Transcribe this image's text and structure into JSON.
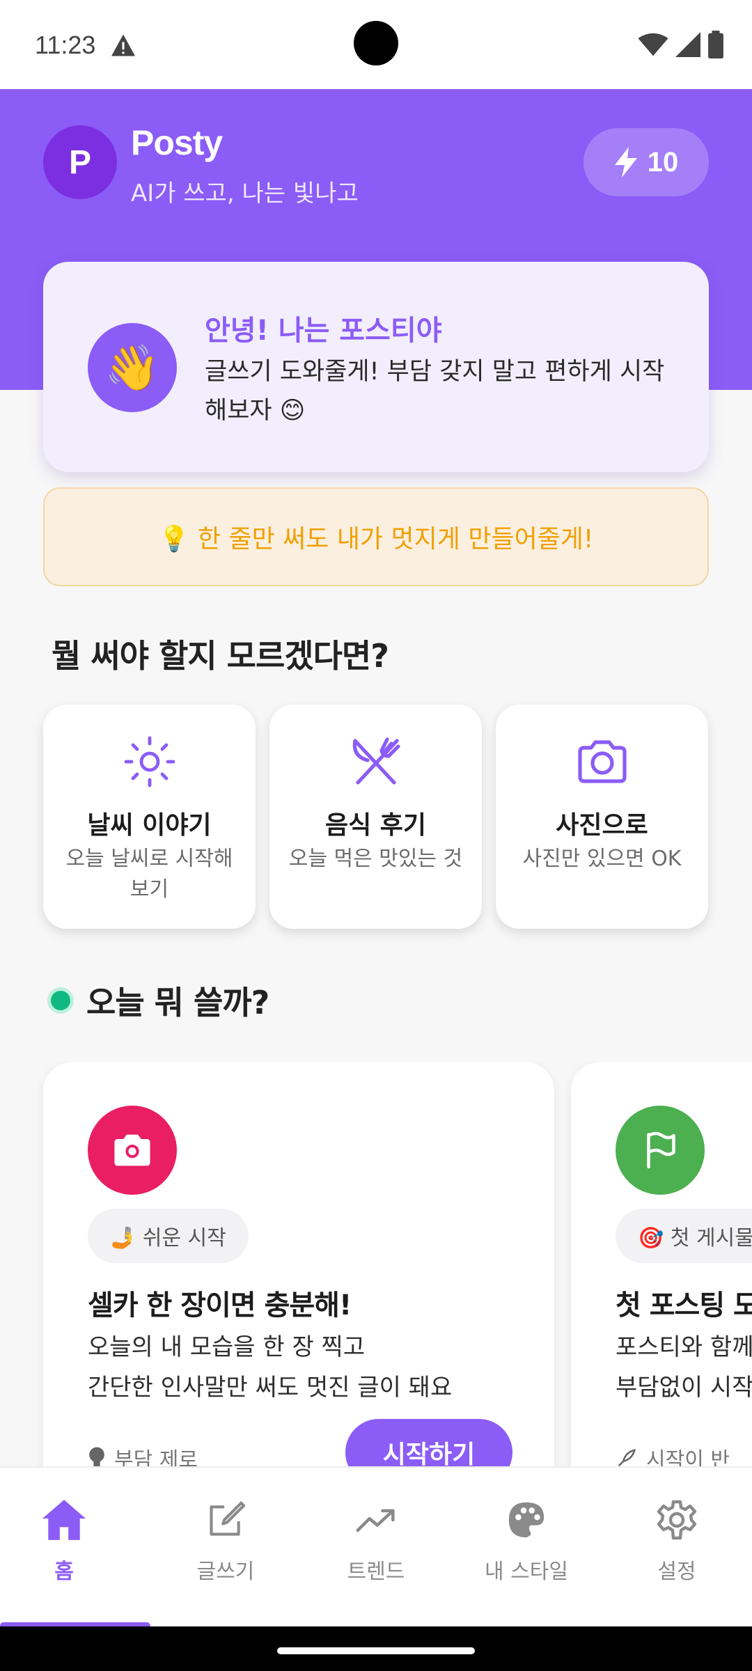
{
  "status_bar": {
    "time": "11:23"
  },
  "header": {
    "avatar_letter": "P",
    "app_name": "Posty",
    "tagline": "AI가 쓰고, 나는 빛나고",
    "credits": "10"
  },
  "greeting": {
    "emoji": "👋",
    "title": "안녕! 나는 포스티야",
    "text": "글쓰기 도와줄게! 부담 갖지 말고 편하게 시작해보자 😊"
  },
  "tip": {
    "text": "💡 한 줄만 써도 내가 멋지게 만들어줄게!"
  },
  "ideas_section": {
    "title": "뭘 써야 할지 모르겠다면?",
    "cards": [
      {
        "icon": "sun-icon",
        "title": "날씨 이야기",
        "subtitle": "오늘 날씨로 시작해보기"
      },
      {
        "icon": "utensils-icon",
        "title": "음식 후기",
        "subtitle": "오늘 먹은 맛있는 것"
      },
      {
        "icon": "camera-icon",
        "title": "사진으로",
        "subtitle": "사진만 있으면 OK"
      }
    ]
  },
  "today_section": {
    "title": "오늘 뭐 쓸까?",
    "topics": [
      {
        "icon": "camera-icon",
        "icon_color": "#e91e63",
        "chip": "🤳 쉬운 시작",
        "title": "셀카 한 장이면 충분해!",
        "desc_line1": "오늘의 내 모습을 한 장 찍고",
        "desc_line2": "간단한 인사말만 써도 멋진 글이 돼요",
        "footer": "부담 제로",
        "button": "시작하기"
      },
      {
        "icon": "flag-icon",
        "icon_color": "#4caf50",
        "chip": "🎯 첫 게시물",
        "title": "첫 포스팅 도",
        "desc_line1": "포스티와 함께",
        "desc_line2": "부담없이 시작",
        "footer": "시작이 반"
      }
    ]
  },
  "bottom_nav": {
    "items": [
      {
        "label": "홈",
        "icon": "home-icon",
        "active": true
      },
      {
        "label": "글쓰기",
        "icon": "edit-icon",
        "active": false
      },
      {
        "label": "트렌드",
        "icon": "trend-icon",
        "active": false
      },
      {
        "label": "내 스타일",
        "icon": "palette-icon",
        "active": false
      },
      {
        "label": "설정",
        "icon": "gear-icon",
        "active": false
      }
    ]
  },
  "colors": {
    "primary": "#8b5cf6",
    "tip_text": "#f0a000",
    "selfie_accent": "#e91e63",
    "flag_accent": "#4caf50",
    "today_dot": "#10b981"
  }
}
